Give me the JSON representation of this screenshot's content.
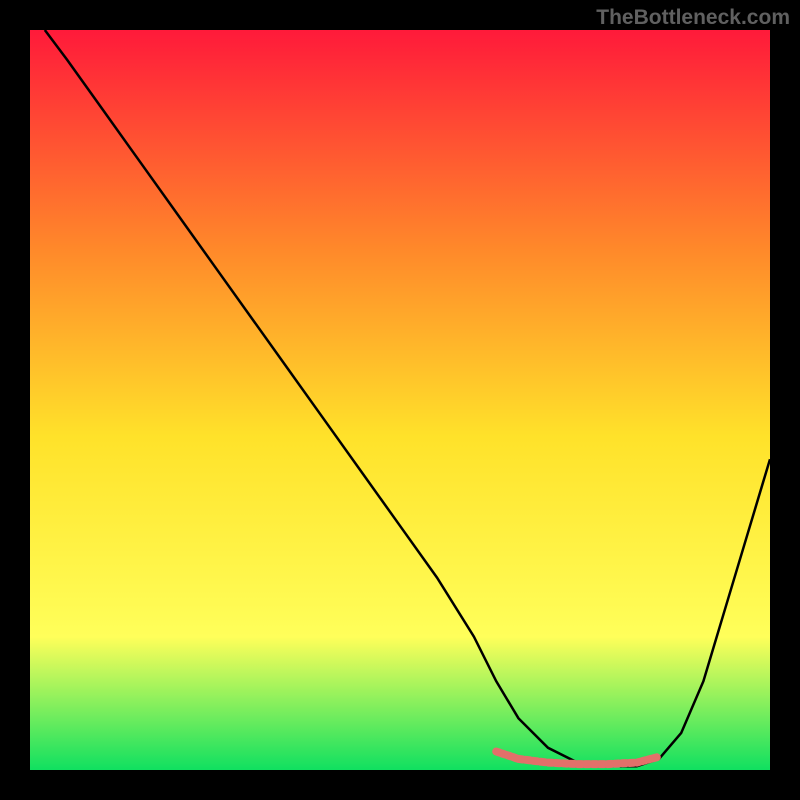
{
  "watermark": "TheBottleneck.com",
  "colors": {
    "background": "#000000",
    "gradient_top": "#ff1a3a",
    "gradient_mid1": "#ff8a2a",
    "gradient_mid2": "#ffe22a",
    "gradient_mid3": "#ffff5a",
    "gradient_bottom": "#10e060",
    "curve": "#000000",
    "marker": "#e2706a"
  },
  "chart_data": {
    "type": "line",
    "title": "",
    "xlabel": "",
    "ylabel": "",
    "xlim": [
      0,
      100
    ],
    "ylim": [
      0,
      100
    ],
    "series": [
      {
        "name": "curve",
        "x": [
          2,
          5,
          10,
          15,
          20,
          25,
          30,
          35,
          40,
          45,
          50,
          55,
          60,
          63,
          66,
          70,
          74,
          78,
          82,
          85,
          88,
          91,
          94,
          97,
          100
        ],
        "values": [
          100,
          96,
          89,
          82,
          75,
          68,
          61,
          54,
          47,
          40,
          33,
          26,
          18,
          12,
          7,
          3,
          1,
          0.5,
          0.5,
          1.5,
          5,
          12,
          22,
          32,
          42
        ]
      },
      {
        "name": "highlight-band",
        "x": [
          63,
          66,
          70,
          74,
          78,
          82,
          85
        ],
        "values": [
          2.5,
          1.5,
          1,
          0.8,
          0.8,
          1,
          1.8
        ]
      }
    ]
  }
}
